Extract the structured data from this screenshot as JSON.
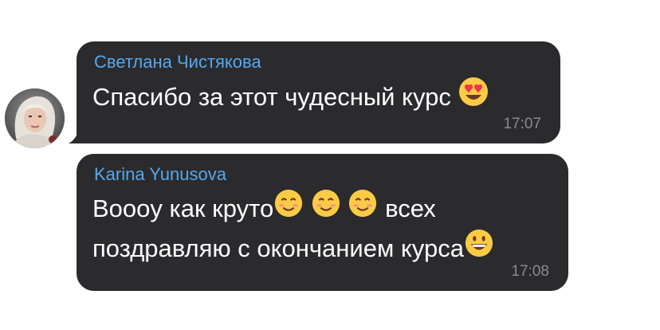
{
  "messages": [
    {
      "sender": "Светлана Чистякова",
      "text": "Спасибо за этот чудесный курс",
      "emoji": "heart-eyes",
      "time": "17:07"
    },
    {
      "sender": "Karina Yunusova",
      "line1_text": "Вoooy как круто",
      "line1_tail": "всех",
      "line2_text": "поздравляю с окончанием курса",
      "emojis_line1": [
        "smiling-face",
        "smiling-face",
        "smiling-face"
      ],
      "emoji_line2": "grinning-face",
      "time": "17:08"
    }
  ],
  "colors": {
    "bubble": "#2b2b2d",
    "sender_name": "#53a8f0",
    "text": "#ffffff",
    "timestamp": "#8a8a8e"
  }
}
